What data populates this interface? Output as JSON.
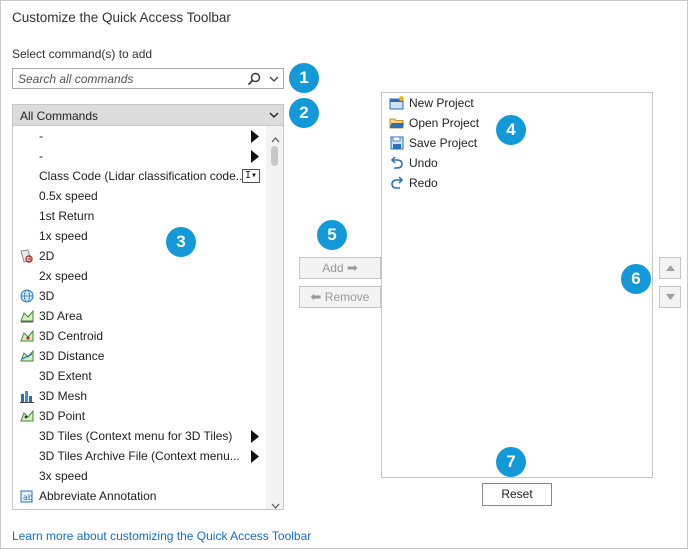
{
  "dialog": {
    "title": "Customize the Quick Access Toolbar",
    "select_label": "Select command(s) to add",
    "search_placeholder": "Search all commands",
    "category": "All Commands",
    "commands": [
      {
        "label": "-",
        "icon": "none",
        "submenu": true
      },
      {
        "label": "-",
        "icon": "none",
        "submenu": true
      },
      {
        "label": "Class Code (Lidar classification code...",
        "icon": "none",
        "control": "I▾"
      },
      {
        "label": "0.5x speed",
        "icon": "none"
      },
      {
        "label": "1st Return",
        "icon": "none"
      },
      {
        "label": "1x speed",
        "icon": "none"
      },
      {
        "label": "2D",
        "icon": "2d-map-icon"
      },
      {
        "label": "2x speed",
        "icon": "none"
      },
      {
        "label": "3D",
        "icon": "3d-globe-icon"
      },
      {
        "label": "3D Area",
        "icon": "3d-area-icon"
      },
      {
        "label": "3D Centroid",
        "icon": "3d-centroid-icon"
      },
      {
        "label": "3D Distance",
        "icon": "3d-distance-icon"
      },
      {
        "label": "3D Extent",
        "icon": "none"
      },
      {
        "label": "3D Mesh",
        "icon": "3d-mesh-icon"
      },
      {
        "label": "3D Point",
        "icon": "3d-point-icon"
      },
      {
        "label": "3D Tiles (Context menu for 3D Tiles)",
        "icon": "none",
        "submenu": true
      },
      {
        "label": "3D Tiles Archive File (Context menu...",
        "icon": "none",
        "submenu": true
      },
      {
        "label": "3x speed",
        "icon": "none"
      },
      {
        "label": "Abbreviate Annotation",
        "icon": "abbreviate-annotation-icon"
      }
    ],
    "add_label": "Add",
    "remove_label": "Remove",
    "toolbar_items": [
      {
        "label": "New Project",
        "icon": "new-project-icon"
      },
      {
        "label": "Open Project",
        "icon": "open-project-icon"
      },
      {
        "label": "Save Project",
        "icon": "save-project-icon"
      },
      {
        "label": "Undo",
        "icon": "undo-icon"
      },
      {
        "label": "Redo",
        "icon": "redo-icon"
      }
    ],
    "reset_label": "Reset",
    "learn_more": "Learn more about customizing the Quick Access Toolbar"
  },
  "callouts": [
    "1",
    "2",
    "3",
    "4",
    "5",
    "6",
    "7"
  ],
  "colors": {
    "callout": "#1499d8",
    "link": "#1a6cc4",
    "dropdown_bg": "#dcdcdc",
    "disabled_text": "#9a9a9a"
  }
}
